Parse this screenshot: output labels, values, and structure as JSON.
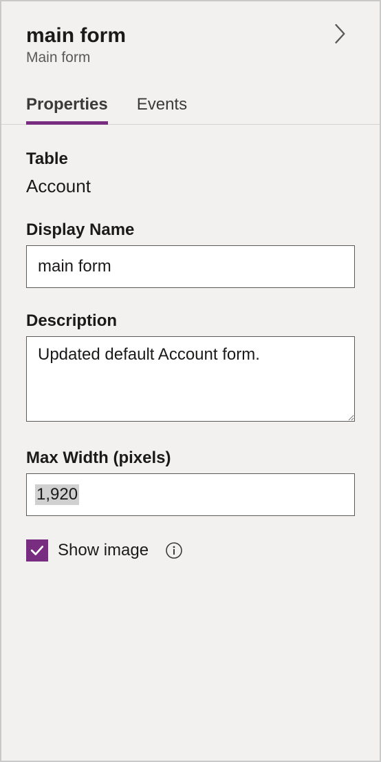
{
  "header": {
    "title": "main form",
    "subtitle": "Main form"
  },
  "tabs": {
    "properties": "Properties",
    "events": "Events"
  },
  "fields": {
    "table": {
      "label": "Table",
      "value": "Account"
    },
    "displayName": {
      "label": "Display Name",
      "value": "main form"
    },
    "description": {
      "label": "Description",
      "value": "Updated default Account form."
    },
    "maxWidth": {
      "label": "Max Width (pixels)",
      "value": "1,920"
    },
    "showImage": {
      "label": "Show image",
      "checked": true
    }
  }
}
